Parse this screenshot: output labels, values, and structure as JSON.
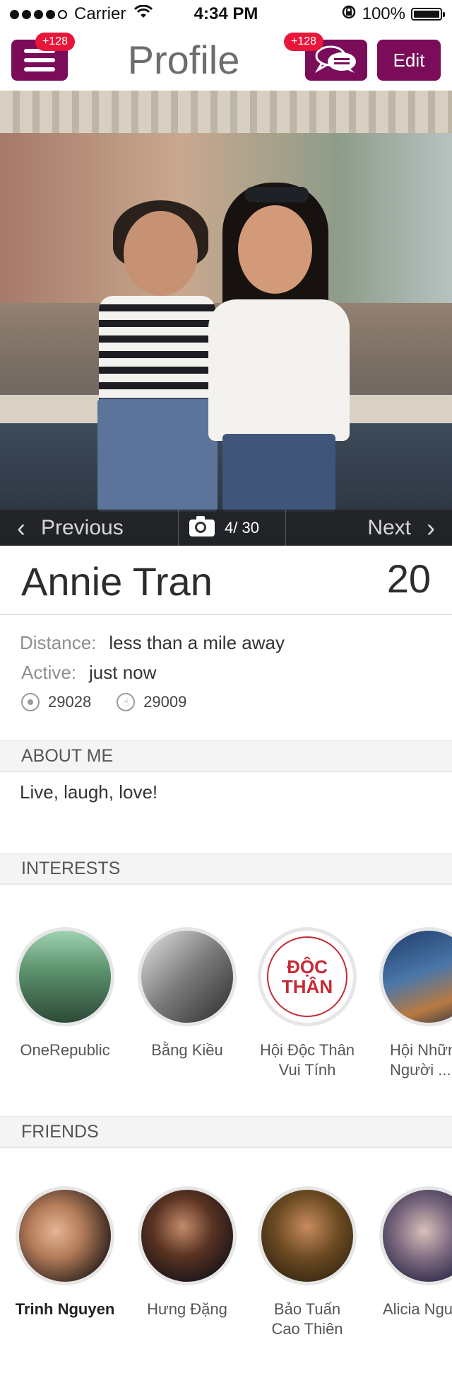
{
  "status_bar": {
    "carrier": "Carrier",
    "time": "4:34 PM",
    "battery": "100%"
  },
  "nav": {
    "title": "Profile",
    "menu_badge": "+128",
    "chat_badge": "+128",
    "edit_label": "Edit",
    "accent_color": "#7a0c5a",
    "badge_color": "#e8163a"
  },
  "photo_nav": {
    "previous_label": "Previous",
    "next_label": "Next",
    "counter": "4/ 30"
  },
  "profile": {
    "name": "Annie Tran",
    "age": "20",
    "distance_label": "Distance:",
    "distance_value": "less than a mile away",
    "active_label": "Active:",
    "active_value": "just now",
    "views": "29028",
    "likes": "29009"
  },
  "about": {
    "header": "ABOUT ME",
    "text": "Live, laugh, love!"
  },
  "interests": {
    "header": "INTERESTS",
    "items": [
      {
        "label": "OneRepublic"
      },
      {
        "label": "Bằng Kiều"
      },
      {
        "label": "Hội Độc Thân Vui Tính",
        "seal_line1": "ĐỘC",
        "seal_line2": "THÂN"
      },
      {
        "label": "Hội Nhữn Người ..."
      }
    ]
  },
  "friends": {
    "header": "FRIENDS",
    "items": [
      {
        "label": "Trinh Nguyen"
      },
      {
        "label": "Hưng Đặng"
      },
      {
        "label": "Bảo Tuấn Cao Thiên"
      },
      {
        "label": "Alicia Ngu"
      }
    ]
  }
}
